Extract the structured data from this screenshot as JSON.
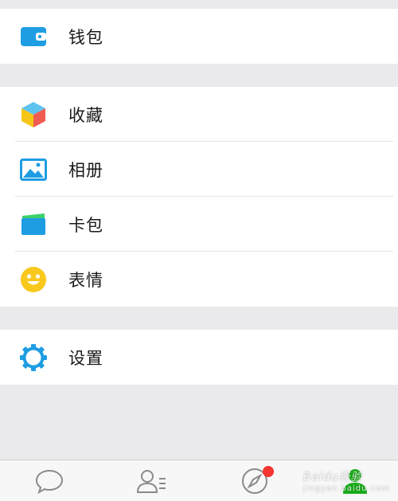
{
  "groups": [
    {
      "items": [
        {
          "label": "钱包",
          "icon": "wallet-icon"
        }
      ]
    },
    {
      "items": [
        {
          "label": "收藏",
          "icon": "favorites-cube-icon"
        },
        {
          "label": "相册",
          "icon": "album-picture-icon"
        },
        {
          "label": "卡包",
          "icon": "card-wallet-icon"
        },
        {
          "label": "表情",
          "icon": "smiley-emoji-icon"
        }
      ]
    },
    {
      "items": [
        {
          "label": "设置",
          "icon": "settings-gear-icon"
        }
      ]
    }
  ],
  "tabbar": {
    "tabs": [
      {
        "icon": "chat-bubble-icon",
        "active": false
      },
      {
        "icon": "contacts-icon",
        "active": false
      },
      {
        "icon": "compass-discover-icon",
        "active": false,
        "badge": true
      },
      {
        "icon": "me-profile-icon",
        "active": true
      }
    ]
  },
  "watermark": {
    "text": "Baidu经验",
    "sub": "jingyan.baidu.com"
  },
  "colors": {
    "background": "#eaeaec",
    "accent_green": "#1aad19",
    "badge_red": "#f43530",
    "icon_blue": "#1e9de3"
  }
}
